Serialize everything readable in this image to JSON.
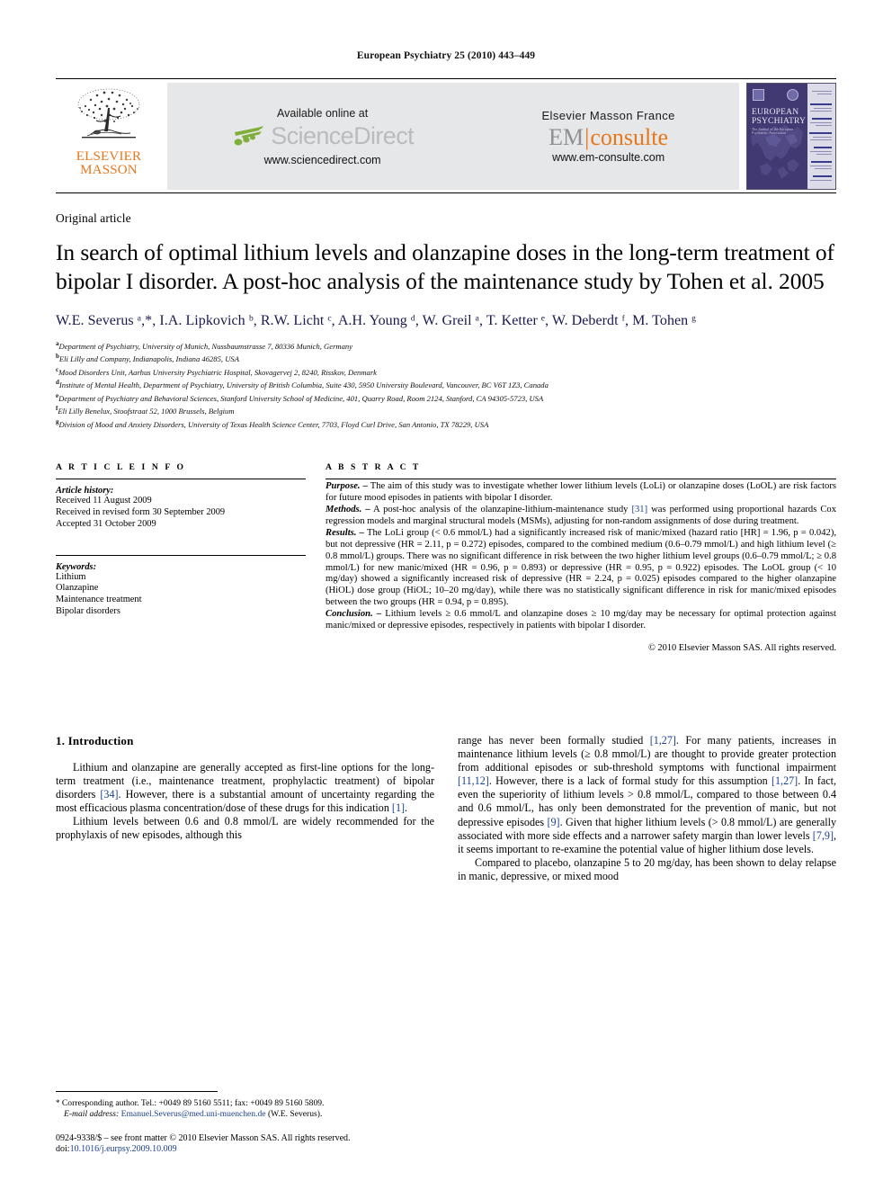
{
  "running_head": "European Psychiatry 25 (2010) 443–449",
  "masthead": {
    "elsevier_line1": "ELSEVIER",
    "elsevier_line2": "MASSON",
    "sciencedirect": {
      "available_text": "Available online at",
      "wordmark": "ScienceDirect",
      "url": "www.sciencedirect.com"
    },
    "emconsulte": {
      "publisher_text": "Elsevier Masson France",
      "wordmark_em": "EM",
      "wordmark_consulte": "consulte",
      "url": "www.em-consulte.com"
    },
    "cover": {
      "title_line1": "EUROPEAN",
      "title_line2": "PSYCHIATRY",
      "subtitle": "The Journal of the European Psychiatric Association"
    }
  },
  "article": {
    "kind": "Original article",
    "title": "In search of optimal lithium levels and olanzapine doses in the long-term treatment of bipolar I disorder. A post-hoc analysis of the maintenance study by Tohen et al. 2005",
    "authors": "W.E. Severus ᵃ,*, I.A. Lipkovich ᵇ, R.W. Licht ᶜ, A.H. Young ᵈ, W. Greil ᵃ, T. Ketter ᵉ, W. Deberdt ᶠ, M. Tohen ᵍ",
    "affiliations": [
      {
        "mark": "a",
        "text": "Department of Psychiatry, University of Munich, Nussbaumstrasse 7, 80336 Munich, Germany"
      },
      {
        "mark": "b",
        "text": "Eli Lilly and Company, Indianapolis, Indiana 46285, USA"
      },
      {
        "mark": "c",
        "text": "Mood Disorders Unit, Aarhus University Psychiatric Hospital, Skovagervej 2, 8240, Risskov, Denmark"
      },
      {
        "mark": "d",
        "text": "Institute of Mental Health, Department of Psychiatry, University of British Columbia, Suite 430, 5950 University Boulevard, Vancouver, BC V6T 1Z3, Canada"
      },
      {
        "mark": "e",
        "text": "Department of Psychiatry and Behavioral Sciences, Stanford University School of Medicine, 401, Quarry Road, Room 2124, Stanford, CA 94305-5723, USA"
      },
      {
        "mark": "f",
        "text": "Eli Lilly Benelux, Stoofstraat 52, 1000 Brussels, Belgium"
      },
      {
        "mark": "g",
        "text": "Division of Mood and Anxiety Disorders, University of Texas Health Science Center, 7703, Floyd Curl Drive, San Antonio, TX 78229, USA"
      }
    ]
  },
  "article_info": {
    "heading": "A R T I C L E  I N F O",
    "history_heading": "Article history:",
    "history": [
      "Received 11 August 2009",
      "Received in revised form 30 September 2009",
      "Accepted 31 October 2009"
    ],
    "keywords_heading": "Keywords:",
    "keywords": [
      "Lithium",
      "Olanzapine",
      "Maintenance treatment",
      "Bipolar disorders"
    ]
  },
  "abstract": {
    "heading": "A B S T R A C T",
    "purpose_label": "Purpose. –",
    "purpose_text": " The aim of this study was to investigate whether lower lithium levels (LoLi) or olanzapine doses (LoOL) are risk factors for future mood episodes in patients with bipolar I disorder.",
    "methods_label": "Methods. –",
    "methods_text_a": " A post-hoc analysis of the olanzapine-lithium-maintenance study ",
    "methods_cite": "[31]",
    "methods_text_b": " was performed using proportional hazards Cox regression models and marginal structural models (MSMs), adjusting for non-random assignments of dose during treatment.",
    "results_label": "Results. –",
    "results_text": " The LoLi group (< 0.6 mmol/L) had a significantly increased risk of manic/mixed (hazard ratio [HR] = 1.96, p = 0.042), but not depressive (HR = 2.11, p = 0.272) episodes, compared to the combined medium (0.6–0.79 mmol/L) and high lithium level (≥ 0.8 mmol/L) groups. There was no significant difference in risk between the two higher lithium level groups (0.6–0.79 mmol/L; ≥ 0.8 mmol/L) for new manic/mixed (HR = 0.96, p = 0.893) or depressive (HR = 0.95, p = 0.922) episodes. The LoOL group (< 10 mg/day) showed a significantly increased risk of depressive (HR = 2.24, p = 0.025) episodes compared to the higher olanzapine (HiOL) dose group (HiOL; 10–20 mg/day), while there was no statistically significant difference in risk for manic/mixed episodes between the two groups (HR = 0.94, p = 0.895).",
    "conclusion_label": "Conclusion. –",
    "conclusion_text": " Lithium levels ≥ 0.6 mmol/L and olanzapine doses ≥ 10 mg/day may be necessary for optimal protection against manic/mixed or depressive episodes, respectively in patients with bipolar I disorder.",
    "copyright": "© 2010 Elsevier Masson SAS. All rights reserved."
  },
  "introduction": {
    "heading": "1. Introduction",
    "left_p1_a": "Lithium and olanzapine are generally accepted as first-line options for the long-term treatment (i.e., maintenance treatment, prophylactic treatment) of bipolar disorders ",
    "left_p1_cite1": "[34]",
    "left_p1_b": ". However, there is a substantial amount of uncertainty regarding the most efficacious plasma concentration/dose of these drugs for this indication ",
    "left_p1_cite2": "[1]",
    "left_p1_c": ".",
    "left_p2": "Lithium levels between 0.6 and 0.8 mmol/L are widely recommended for the prophylaxis of new episodes, although this",
    "right_p1_a": "range has never been formally studied ",
    "right_p1_cite1": "[1,27]",
    "right_p1_b": ". For many patients, increases in maintenance lithium levels (≥ 0.8 mmol/L) are thought to provide greater protection from additional episodes or sub-threshold symptoms with functional impairment ",
    "right_p1_cite2": "[11,12]",
    "right_p1_c": ". However, there is a lack of formal study for this assumption ",
    "right_p1_cite3": "[1,27]",
    "right_p1_d": ". In fact, even the superiority of lithium levels > 0.8 mmol/L, compared to those between 0.4 and 0.6 mmol/L, has only been demonstrated for the prevention of manic, but not depressive episodes ",
    "right_p1_cite4": "[9]",
    "right_p1_e": ". Given that higher lithium levels (> 0.8 mmol/L) are generally associated with more side effects and a narrower safety margin than lower levels ",
    "right_p1_cite5": "[7,9]",
    "right_p1_f": ", it seems important to re-examine the potential value of higher lithium dose levels.",
    "right_p2": "Compared to placebo, olanzapine 5 to 20 mg/day, has been shown to delay relapse in manic, depressive, or mixed mood"
  },
  "footnotes": {
    "corresponding_star": "*",
    "corresponding_text": " Corresponding author. Tel.: +0049 89 5160 5511; fax: +0049 89 5160 5809.",
    "email_label": "E-mail address:",
    "email_address": "Emanuel.Severus@med.uni-muenchen.de",
    "email_suffix": " (W.E. Severus).",
    "issn_line": "0924-9338/$ – see front matter © 2010 Elsevier Masson SAS. All rights reserved.",
    "doi_label": "doi:",
    "doi_value": "10.1016/j.eurpsy.2009.10.009"
  }
}
